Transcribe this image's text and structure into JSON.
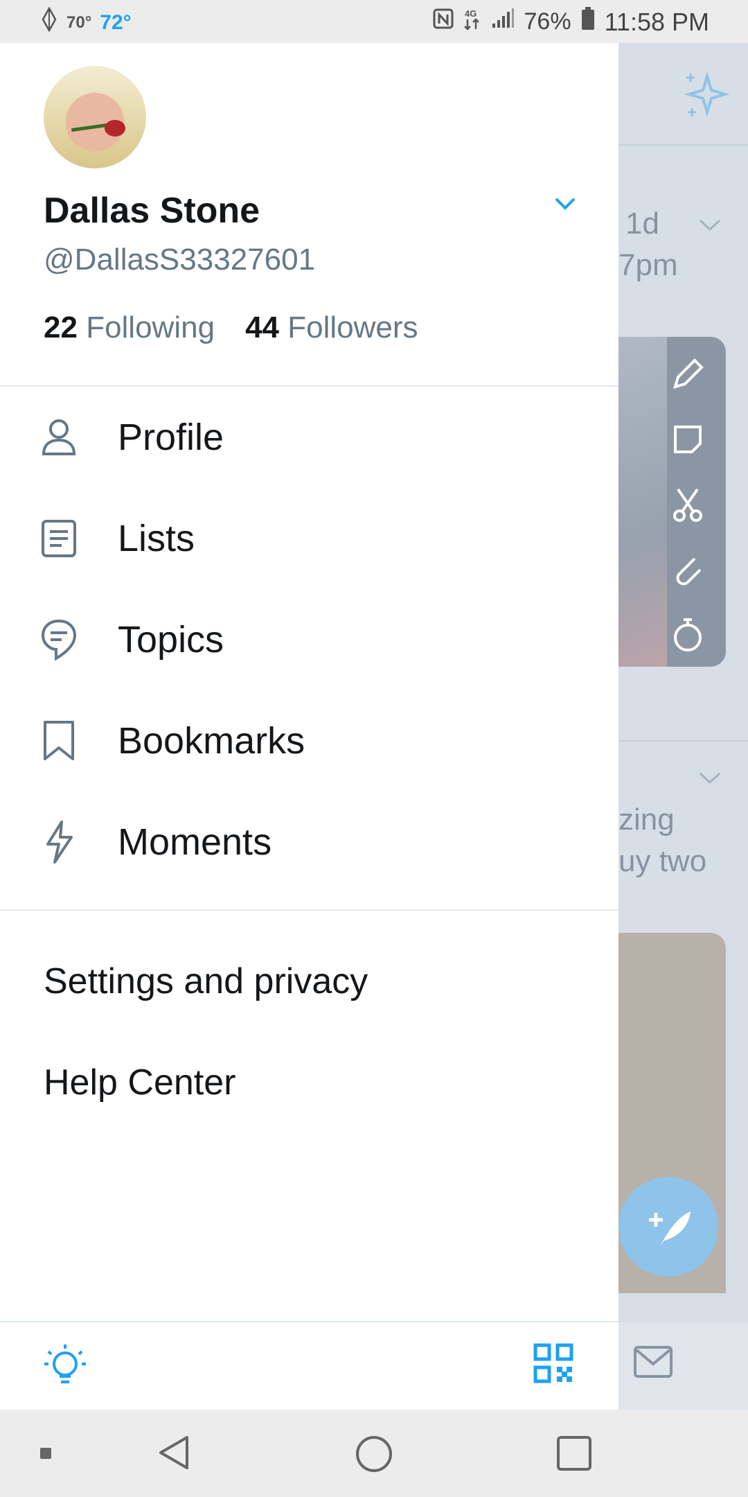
{
  "status_bar": {
    "temp_low": "70°",
    "temp_high": "72°",
    "battery_pct": "76%",
    "time": "11:58 PM"
  },
  "profile": {
    "name": "Dallas Stone",
    "handle": "@DallasS33327601",
    "following_count": "22",
    "following_label": "Following",
    "followers_count": "44",
    "followers_label": "Followers"
  },
  "menu": [
    {
      "label": "Profile",
      "icon": "person-icon"
    },
    {
      "label": "Lists",
      "icon": "list-icon"
    },
    {
      "label": "Topics",
      "icon": "topics-icon"
    },
    {
      "label": "Bookmarks",
      "icon": "bookmark-icon"
    },
    {
      "label": "Moments",
      "icon": "lightning-icon"
    }
  ],
  "secondary_menu": {
    "settings": "Settings and privacy",
    "help": "Help Center"
  },
  "background_timeline": {
    "time_ago": "1d",
    "time_partial": "7pm",
    "text_line1": "zing",
    "text_line2": "uy two"
  },
  "colors": {
    "accent": "#1da1f2",
    "text_primary": "#14171a",
    "text_secondary": "#657786"
  }
}
